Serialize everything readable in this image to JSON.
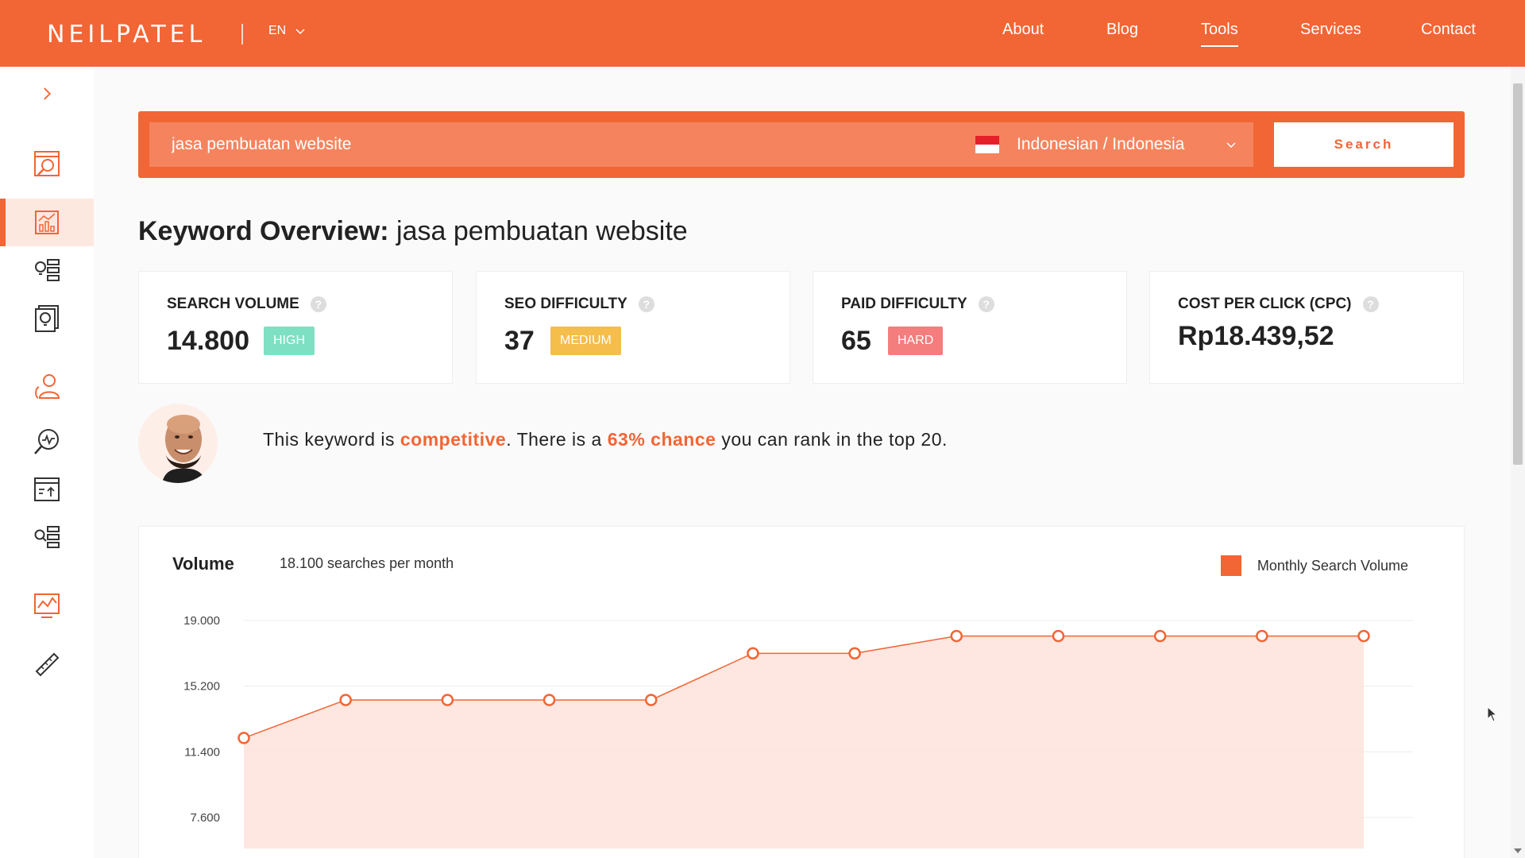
{
  "header": {
    "logo": "NEILPATEL",
    "language": "EN",
    "nav": [
      {
        "label": "About"
      },
      {
        "label": "Blog"
      },
      {
        "label": "Tools"
      },
      {
        "label": "Services"
      },
      {
        "label": "Contact"
      }
    ],
    "active_nav": "Tools"
  },
  "sidebar": {
    "expand_icon": "chevron-right-icon",
    "items": [
      {
        "icon": "site-audit-icon"
      },
      {
        "icon": "keyword-overview-icon",
        "active": true
      },
      {
        "icon": "keyword-ideas-icon"
      },
      {
        "icon": "content-ideas-icon"
      },
      {
        "icon": "user-profile-icon"
      },
      {
        "icon": "traffic-analyzer-icon"
      },
      {
        "icon": "rank-tracker-icon"
      },
      {
        "icon": "backlinks-icon"
      },
      {
        "icon": "analytics-chart-icon"
      },
      {
        "icon": "link-icon"
      }
    ]
  },
  "search": {
    "keyword": "jasa pembuatan website",
    "location": "Indonesian / Indonesia",
    "button_label": "Search"
  },
  "overview": {
    "title_bold": "Keyword Overview:",
    "title_keyword": "jasa pembuatan website",
    "metrics": [
      {
        "label": "SEARCH VOLUME",
        "value": "14.800",
        "badge": "HIGH",
        "badge_color": "#7ee0c2"
      },
      {
        "label": "SEO DIFFICULTY",
        "value": "37",
        "badge": "MEDIUM",
        "badge_color": "#f5bd4a"
      },
      {
        "label": "PAID DIFFICULTY",
        "value": "65",
        "badge": "HARD",
        "badge_color": "#f47d7d"
      },
      {
        "label": "COST PER CLICK (CPC)",
        "value": "Rp18.439,52",
        "badge": "",
        "badge_color": ""
      }
    ],
    "help_glyph": "?"
  },
  "insight": {
    "prefix": "This keyword is ",
    "highlight1": "competitive",
    "middle": ". There is a ",
    "highlight2": "63% chance",
    "suffix": " you can rank in the top 20."
  },
  "colors": {
    "brand": "#f26535",
    "area_fill": "#fde3da"
  },
  "chart_data": {
    "type": "area",
    "title": "Volume",
    "subtitle": "18.100 searches per month",
    "legend": [
      "Monthly Search Volume"
    ],
    "ytick_labels": [
      "19.000",
      "15.200",
      "11.400",
      "7.600"
    ],
    "ytick_values": [
      19000,
      15200,
      11400,
      7600
    ],
    "ylim": [
      5800,
      19000
    ],
    "grid": true,
    "legend_position": "top-right",
    "series": [
      {
        "name": "Monthly Search Volume",
        "values": [
          12200,
          14400,
          14400,
          14400,
          14400,
          17100,
          17100,
          18100,
          18100,
          18100,
          18100,
          18100
        ]
      }
    ]
  }
}
